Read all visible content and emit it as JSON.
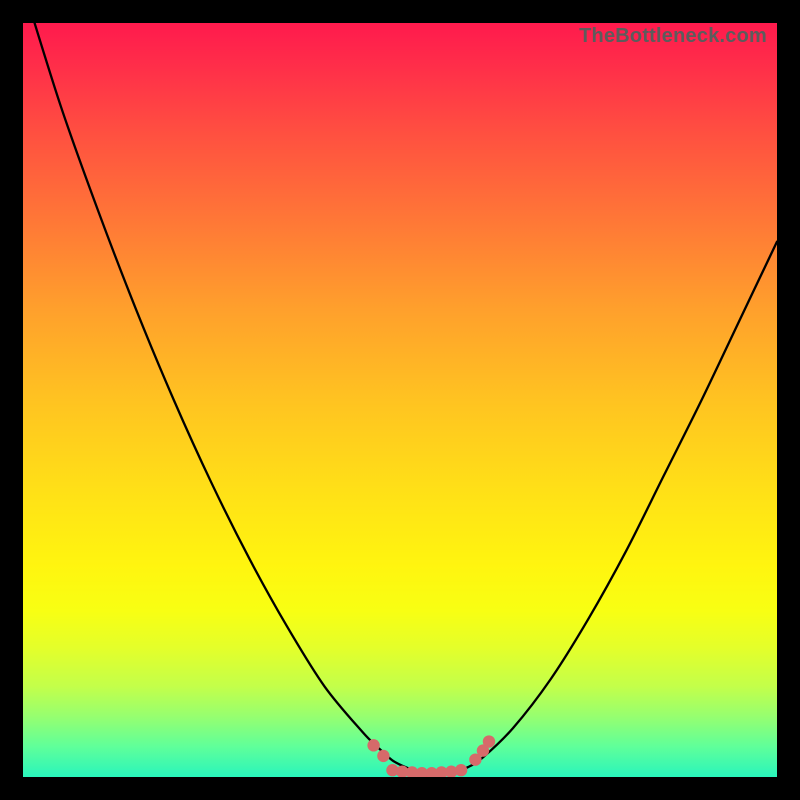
{
  "attribution": "TheBottleneck.com",
  "chart_data": {
    "type": "line",
    "title": "",
    "xlabel": "",
    "ylabel": "",
    "xlim": [
      0,
      100
    ],
    "ylim": [
      0,
      100
    ],
    "series": [
      {
        "name": "bottleneck-curve",
        "x": [
          0,
          5,
          10,
          15,
          20,
          25,
          30,
          35,
          40,
          45,
          47,
          49,
          51,
          53,
          55,
          57,
          59,
          61,
          65,
          70,
          75,
          80,
          85,
          90,
          95,
          100
        ],
        "y": [
          105,
          89,
          75,
          62,
          50,
          39,
          29,
          20,
          12,
          6,
          4,
          2.2,
          1.2,
          0.6,
          0.4,
          0.6,
          1.3,
          2.6,
          6.5,
          13,
          21,
          30,
          40,
          50,
          60.5,
          71
        ]
      }
    ],
    "markers": {
      "name": "highlight-dots",
      "color": "#d66a6a",
      "points": [
        {
          "x": 46.5,
          "y": 4.2
        },
        {
          "x": 47.8,
          "y": 2.8
        },
        {
          "x": 49.0,
          "y": 0.9
        },
        {
          "x": 50.3,
          "y": 0.7
        },
        {
          "x": 51.6,
          "y": 0.6
        },
        {
          "x": 52.9,
          "y": 0.5
        },
        {
          "x": 54.2,
          "y": 0.5
        },
        {
          "x": 55.5,
          "y": 0.6
        },
        {
          "x": 56.8,
          "y": 0.7
        },
        {
          "x": 58.1,
          "y": 0.9
        },
        {
          "x": 60.0,
          "y": 2.3
        },
        {
          "x": 61.0,
          "y": 3.5
        },
        {
          "x": 61.8,
          "y": 4.7
        }
      ]
    }
  }
}
